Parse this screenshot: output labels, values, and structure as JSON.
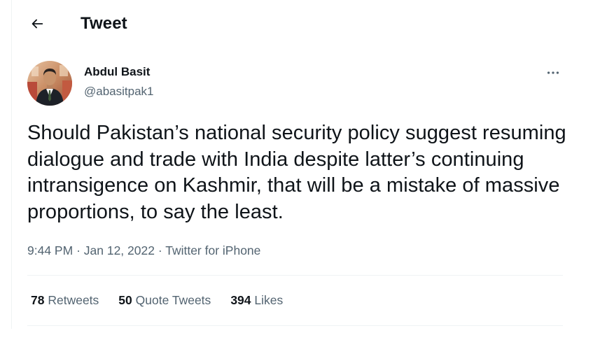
{
  "header": {
    "back_icon": "arrow-left-icon",
    "title": "Tweet"
  },
  "author": {
    "display_name": "Abdul Basit",
    "handle": "@abasitpak1",
    "avatar": "user-avatar-photo",
    "more_icon": "more-horizontal-icon"
  },
  "tweet": {
    "text": "Should Pakistan’s national security policy suggest resuming dialogue and trade with India despite latter’s continuing intransigence on Kashmir, that will be a mistake of massive proportions, to say the least.",
    "time": "9:44 PM",
    "separator": "·",
    "date": "Jan 12, 2022",
    "source": "Twitter for iPhone"
  },
  "stats": {
    "retweets_count": "78",
    "retweets_label": "Retweets",
    "quotes_count": "50",
    "quotes_label": "Quote Tweets",
    "likes_count": "394",
    "likes_label": "Likes"
  },
  "colors": {
    "text_primary": "#0f1419",
    "text_secondary": "#536471",
    "divider": "#eff3f4"
  }
}
